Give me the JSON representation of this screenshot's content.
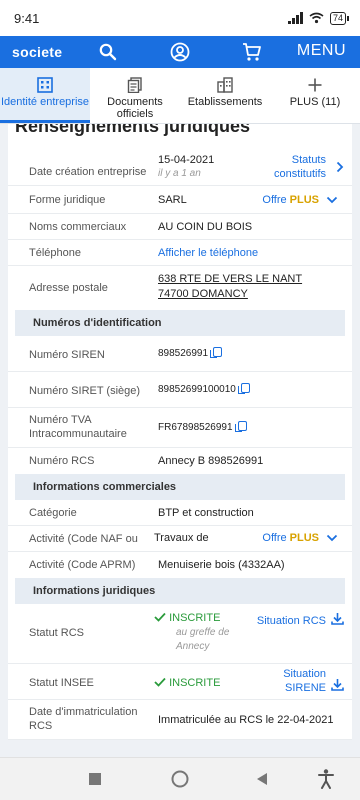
{
  "status_bar": {
    "time": "9:41",
    "battery": "74"
  },
  "app_bar": {
    "logo": "societe",
    "menu_label": "MENU"
  },
  "tabs": [
    {
      "label": "Identité entreprise",
      "icon": "building-icon",
      "active": true
    },
    {
      "label": "Documents officiels",
      "icon": "documents-icon",
      "active": false
    },
    {
      "label": "Etablissements",
      "icon": "establishments-icon",
      "active": false
    },
    {
      "label": "PLUS (11)",
      "icon": "plus-icon",
      "active": false
    }
  ],
  "card": {
    "title": "Renseignements juridiques"
  },
  "rows": {
    "creation": {
      "label": "Date création entreprise",
      "value": "15-04-2021",
      "sub": "il y a 1 an",
      "link": "Statuts constitutifs"
    },
    "forme": {
      "label": "Forme juridique",
      "value": "SARL",
      "offre": "Offre",
      "plus": "PLUS"
    },
    "noms": {
      "label": "Noms commerciaux",
      "value": "AU COIN DU BOIS"
    },
    "telephone": {
      "label": "Téléphone",
      "value": "Afficher le téléphone"
    },
    "adresse": {
      "label": "Adresse postale",
      "value": "638 RTE DE VERS LE NANT 74700 DOMANCY"
    }
  },
  "section_ids": "Numéros d'identification",
  "ids": {
    "siren": {
      "label": "Numéro SIREN",
      "value": "898526991"
    },
    "siret": {
      "label": "Numéro SIRET (siège)",
      "value": "89852699100010"
    },
    "tva": {
      "label": "Numéro TVA Intracommunautaire",
      "value": "FR67898526991"
    },
    "rcs": {
      "label": "Numéro RCS",
      "value": "Annecy B 898526991"
    }
  },
  "section_commerciales": "Informations commerciales",
  "commerciales": {
    "categorie": {
      "label": "Catégorie",
      "value": "BTP et construction"
    },
    "naf": {
      "label": "Activité (Code NAF ou",
      "value": "Travaux de",
      "offre": "Offre",
      "plus": "PLUS"
    },
    "aprm": {
      "label": "Activité (Code APRM)",
      "value": "Menuiserie bois (4332AA)"
    }
  },
  "section_juridiques": "Informations juridiques",
  "juridiques": {
    "statut_rcs": {
      "label": "Statut RCS",
      "value": "INSCRITE",
      "sub": "au greffe de Annecy",
      "link": "Situation RCS"
    },
    "statut_insee": {
      "label": "Statut INSEE",
      "value": "INSCRITE",
      "link": "Situation SIRENE"
    },
    "immatriculation": {
      "label": "Date d'immatriculation RCS",
      "value": "Immatriculée au RCS le 22-04-2021"
    }
  },
  "colors": {
    "brand": "#1a6fe0",
    "plus": "#d8a200",
    "success": "#2a9b3b"
  }
}
